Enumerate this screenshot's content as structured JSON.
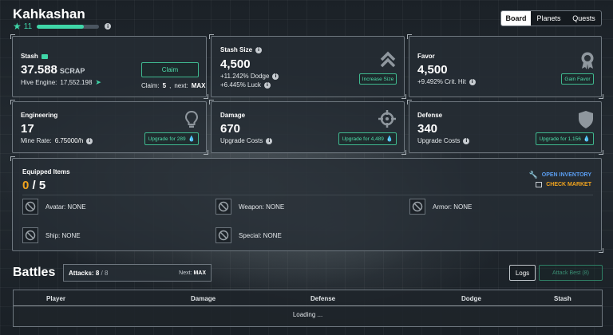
{
  "header": {
    "title": "Kahkashan",
    "level": "11",
    "xp_fraction": 0.76
  },
  "tabs": [
    {
      "label": "Board",
      "active": true
    },
    {
      "label": "Planets"
    },
    {
      "label": "Quests"
    }
  ],
  "stash": {
    "title": "Stash",
    "value": "37.588",
    "unit": "SCRAP",
    "hive_label": "Hive Engine:",
    "hive_value": "17,552.198",
    "claim_label": "Claim",
    "claim_text": "Claim:",
    "claim_value": "5",
    "next_text": "next:",
    "next_value": "MAX"
  },
  "stash_size": {
    "title": "Stash Size",
    "value": "4,500",
    "dodge": "+11.242% Dodge",
    "luck": "+6.445% Luck",
    "button": "Increase Size",
    "icon": "chevron-up-icon"
  },
  "favor": {
    "title": "Favor",
    "value": "4,500",
    "crit": "+9.492% Crit. Hit",
    "button": "Gain Favor",
    "icon": "medal-icon"
  },
  "engineering": {
    "title": "Engineering",
    "value": "17",
    "rate_label": "Mine Rate:",
    "rate_value": "6.75000/h",
    "button": "Upgrade for 289",
    "icon": "lightbulb-icon"
  },
  "damage": {
    "title": "Damage",
    "value": "670",
    "sub": "Upgrade Costs",
    "button": "Upgrade for 4,489",
    "icon": "crosshair-icon"
  },
  "defense": {
    "title": "Defense",
    "value": "340",
    "sub": "Upgrade Costs",
    "button": "Upgrade for 1,156",
    "icon": "shield-icon"
  },
  "equipped": {
    "title": "Equipped Items",
    "count": "0",
    "total": "/ 5",
    "open_inventory": "OPEN INVENTORY",
    "check_market": "CHECK MARKET",
    "slots": [
      {
        "label": "Avatar: NONE"
      },
      {
        "label": "Weapon: NONE"
      },
      {
        "label": "Armor: NONE"
      },
      {
        "label": "Ship: NONE"
      },
      {
        "label": "Special: NONE"
      }
    ]
  },
  "battles": {
    "title": "Battles",
    "attacks_label": "Attacks:",
    "attacks_value": "8",
    "attacks_total": "/ 8",
    "next_label": "Next:",
    "next_value": "MAX",
    "logs": "Logs",
    "attack_best": "Attack Best (8)",
    "columns": [
      "Player",
      "Damage",
      "Defense",
      "Dodge",
      "Stash"
    ],
    "loading": "Loading ..."
  },
  "colors": {
    "accent": "#3fd6a8",
    "orange": "#f0a31e",
    "link_blue": "#5a9df0"
  }
}
